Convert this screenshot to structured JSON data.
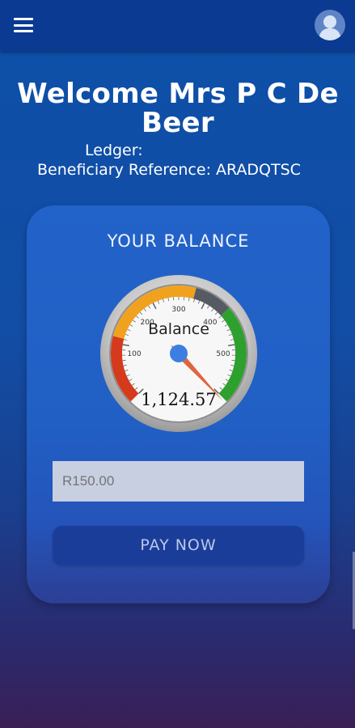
{
  "header": {
    "menu_icon": "hamburger-menu-icon",
    "profile_icon": "user-avatar-icon"
  },
  "welcome": {
    "title": "Welcome Mrs P C De Beer",
    "ledger_label": "Ledger:",
    "beneficiary_label": "Beneficiary Reference: ARADQTSC"
  },
  "balance_card": {
    "title": "YOUR BALANCE",
    "gauge": {
      "label": "Balance",
      "value_text": "1,124.57",
      "value": 1124.57,
      "ticks": [
        "100",
        "200",
        "300",
        "400",
        "500"
      ],
      "zones": [
        {
          "color": "#d63a1c"
        },
        {
          "color": "#f0a21e"
        },
        {
          "color": "#555a63"
        },
        {
          "color": "#2ea02e"
        }
      ],
      "needle_color": "#e0653f",
      "hub_color": "#3d7fe0"
    },
    "amount_input": {
      "value": "",
      "placeholder": "R150.00"
    },
    "pay_button_label": "PAY NOW"
  }
}
